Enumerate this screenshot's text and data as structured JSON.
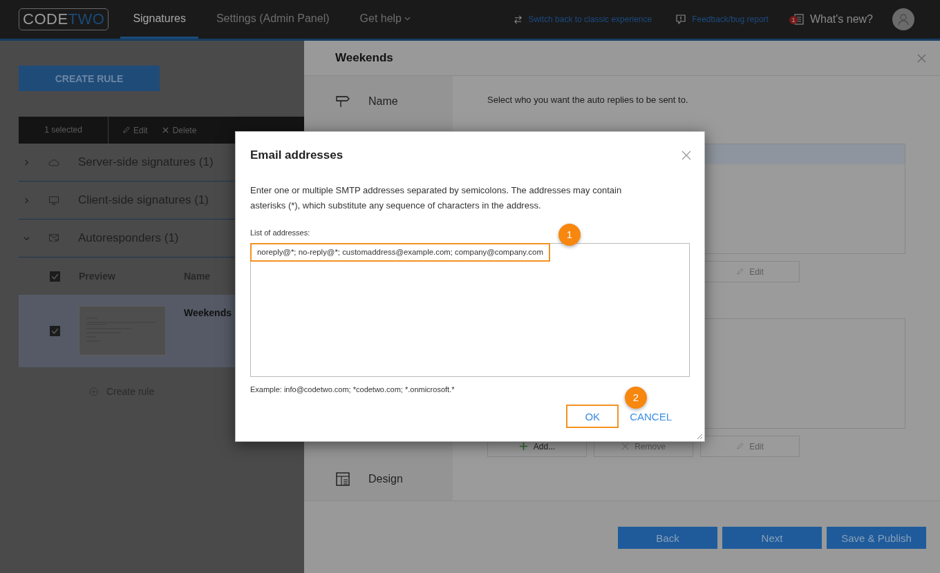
{
  "top_bar": {
    "logo": {
      "first": "CODE",
      "second": "TWO"
    },
    "tabs": [
      {
        "label": "Signatures",
        "selected": true
      },
      {
        "label": "Settings (Admin Panel)",
        "selected": false
      },
      {
        "label": "Get help",
        "selected": false,
        "dropdown": true
      }
    ],
    "links": [
      {
        "kind": "switch",
        "label": "Switch back to classic experience"
      },
      {
        "kind": "feedback",
        "label": "Feedback/bug report"
      },
      {
        "kind": "news",
        "label": "What's new?",
        "badge": "1"
      }
    ]
  },
  "left_pane": {
    "create_button": "CREATE RULE",
    "toolbar": {
      "selection": "1 selected",
      "actions": [
        {
          "kind": "edit",
          "label": "Edit"
        },
        {
          "kind": "delete",
          "label": "Delete"
        }
      ]
    },
    "groups": [
      {
        "kind": "cloud",
        "title": "Server-side signatures (1)",
        "expanded": false
      },
      {
        "kind": "monitor",
        "title": "Client-side signatures (1)",
        "expanded": false
      },
      {
        "kind": "mail",
        "title": "Autoresponders (1)",
        "expanded": true
      }
    ],
    "table": {
      "columns": [
        "Preview",
        "Name"
      ],
      "header_checked": true,
      "rows": [
        {
          "name": "Weekends",
          "checked": true,
          "selected": true
        }
      ]
    },
    "create_link": "Create rule"
  },
  "rule_panel": {
    "title": "Weekends",
    "steps": [
      {
        "kind": "signpost",
        "label": "Name"
      },
      {
        "kind": "layout",
        "label": "Design"
      }
    ],
    "intro": "Select who you want the auto replies to be sent to.",
    "lists": [
      {
        "buttons": [
          {
            "kind": "edit",
            "label": "Edit",
            "disabled": true
          }
        ]
      },
      {
        "buttons": [
          {
            "kind": "add",
            "label": "Add...",
            "disabled": false
          },
          {
            "kind": "remove",
            "label": "Remove",
            "disabled": true
          },
          {
            "kind": "edit",
            "label": "Edit",
            "disabled": true
          }
        ]
      }
    ],
    "footer_buttons": [
      "Back",
      "Next",
      "Save & Publish"
    ]
  },
  "dialog": {
    "title": "Email addresses",
    "description": "Enter one or multiple SMTP addresses separated by semicolons. The addresses may contain asterisks (*), which substitute any sequence of characters in the address.",
    "field_label": "List of addresses:",
    "value": "noreply@*; no-reply@*; customaddress@example.com; company@company.com",
    "example": "Example: info@codetwo.com; *codetwo.com; *.onmicrosoft.*",
    "buttons": [
      {
        "kind": "primary",
        "label": "OK",
        "highlighted": true
      },
      {
        "kind": "secondary",
        "label": "CANCEL",
        "highlighted": false
      }
    ]
  },
  "callouts": [
    "1",
    "2"
  ]
}
